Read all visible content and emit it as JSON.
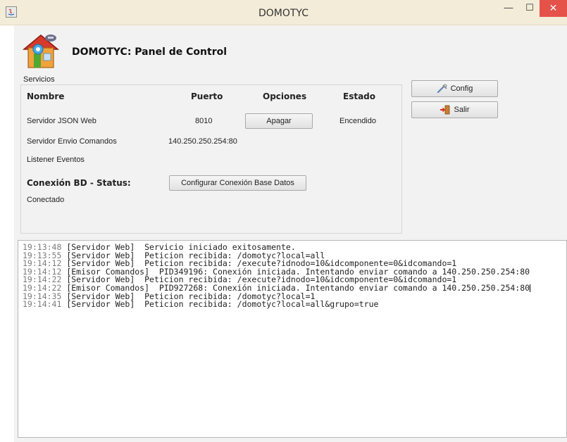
{
  "window": {
    "title": "DOMOTYC",
    "minimize": "—",
    "maximize": "☐",
    "close": "✕"
  },
  "header": {
    "title": "DOMOTYC: Panel de Control"
  },
  "services": {
    "legend": "Servicios",
    "columns": {
      "name": "Nombre",
      "port": "Puerto",
      "options": "Opciones",
      "status": "Estado"
    },
    "rows": [
      {
        "name": "Servidor JSON Web",
        "port": "8010",
        "option": "Apagar",
        "status": "Encendido"
      },
      {
        "name": "Servidor Envio Comandos",
        "port": "140.250.250.254:80",
        "option": "",
        "status": ""
      },
      {
        "name": "Listener Eventos",
        "port": "",
        "option": "",
        "status": ""
      }
    ],
    "db": {
      "label": "Conexión BD - Status:",
      "button": "Configurar Conexión Base Datos",
      "status": "Conectado"
    }
  },
  "side_buttons": {
    "config": "Config",
    "exit": "Salir"
  },
  "log": {
    "lines": [
      {
        "time": "19:13:48",
        "text": "[Servidor Web]  Servicio iniciado exitosamente."
      },
      {
        "time": "19:13:55",
        "text": "[Servidor Web]  Peticion recibida: /domotyc?local=all"
      },
      {
        "time": "19:14:12",
        "text": "[Servidor Web]  Peticion recibida: /execute?idnodo=10&idcomponente=0&idcomando=1"
      },
      {
        "time": "19:14:12",
        "text": "[Emisor Comandos]  PID349196: Conexión iniciada. Intentando enviar comando a 140.250.250.254:80"
      },
      {
        "time": "19:14:22",
        "text": "[Servidor Web]  Peticion recibida: /execute?idnodo=10&idcomponente=0&idcomando=1"
      },
      {
        "time": "19:14:22",
        "text": "[Emisor Comandos]  PID927268: Conexión iniciada. Intentando enviar comando a 140.250.250.254:80"
      },
      {
        "time": "19:14:35",
        "text": "[Servidor Web]  Peticion recibida: /domotyc?local=1"
      },
      {
        "time": "19:14:41",
        "text": "[Servidor Web]  Peticion recibida: /domotyc?local=all&grupo=true"
      }
    ]
  },
  "colors": {
    "titlebar": "#f3ecd8",
    "close_button": "#e5524a",
    "panel_background": "#f2f2f2",
    "log_time": "#7c7c7c"
  }
}
